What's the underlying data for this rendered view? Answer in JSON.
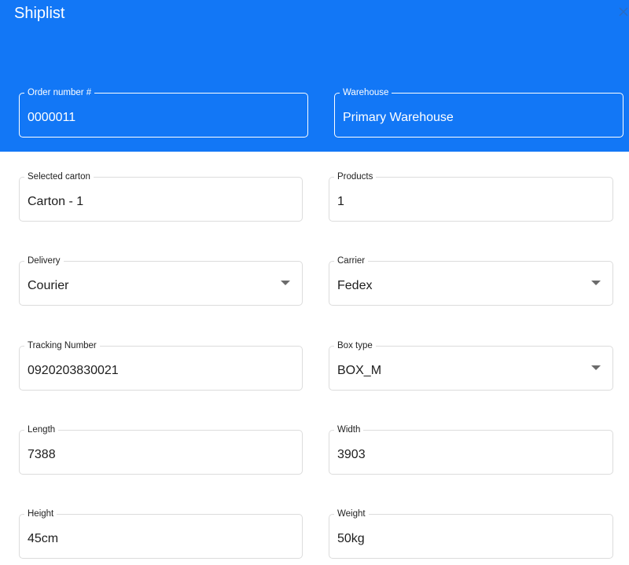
{
  "header": {
    "title": "Shiplist",
    "close_icon": "close-icon",
    "background_color": "#1277f6"
  },
  "header_fields": {
    "order_number": {
      "label": "Order number #",
      "value": "0000011"
    },
    "warehouse": {
      "label": "Warehouse",
      "value": "Primary Warehouse"
    }
  },
  "form": {
    "selected_carton": {
      "label": "Selected carton",
      "value": "Carton - 1"
    },
    "products": {
      "label": "Products",
      "value": "1"
    },
    "delivery": {
      "label": "Delivery",
      "value": "Courier",
      "icon": "chevron-down-icon"
    },
    "carrier": {
      "label": "Carrier",
      "value": "Fedex",
      "icon": "chevron-down-icon"
    },
    "tracking_number": {
      "label": "Tracking Number",
      "value": "0920203830021"
    },
    "box_type": {
      "label": "Box type",
      "value": "BOX_M",
      "icon": "chevron-down-icon"
    },
    "length": {
      "label": "Length",
      "value": "7388"
    },
    "width": {
      "label": "Width",
      "value": "3903"
    },
    "height": {
      "label": "Height",
      "value": "45cm"
    },
    "weight": {
      "label": "Weight",
      "value": "50kg"
    }
  }
}
